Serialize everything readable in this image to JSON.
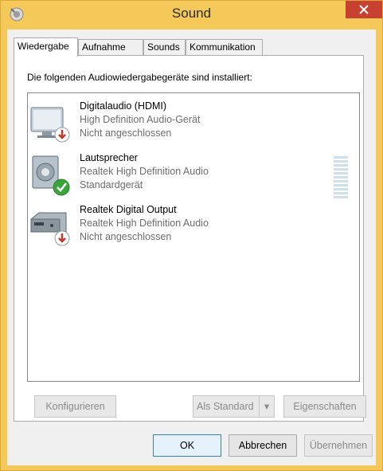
{
  "window": {
    "title": "Sound",
    "close_icon": "close-icon",
    "app_icon": "speaker-icon"
  },
  "tabs": [
    {
      "label": "Wiedergabe",
      "active": true
    },
    {
      "label": "Aufnahme",
      "active": false
    },
    {
      "label": "Sounds",
      "active": false
    },
    {
      "label": "Kommunikation",
      "active": false
    }
  ],
  "panel": {
    "instruction": "Die folgenden Audiowiedergabegeräte sind installiert:",
    "devices": [
      {
        "name": "Digitalaudio (HDMI)",
        "driver": "High Definition Audio-Gerät",
        "status": "Nicht angeschlossen",
        "icon": "monitor-icon",
        "badge": "disconnected-badge-icon"
      },
      {
        "name": "Lautsprecher",
        "driver": "Realtek High Definition Audio",
        "status": "Standardgerät",
        "icon": "speaker-icon",
        "badge": "default-checkmark-icon",
        "level": 0
      },
      {
        "name": "Realtek Digital Output",
        "driver": "Realtek High Definition Audio",
        "status": "Nicht angeschlossen",
        "icon": "digital-output-icon",
        "badge": "disconnected-badge-icon"
      }
    ],
    "buttons": {
      "configure": "Konfigurieren",
      "set_default": "Als Standard",
      "properties": "Eigenschaften"
    }
  },
  "footer": {
    "ok": "OK",
    "cancel": "Abbrechen",
    "apply": "Übernehmen"
  },
  "colors": {
    "title_bar": "#f4c95a",
    "close_button": "#c8402f",
    "check_green": "#3aa53a",
    "disconnected_red": "#c0392b",
    "disabled_text": "#8a8a8a"
  }
}
